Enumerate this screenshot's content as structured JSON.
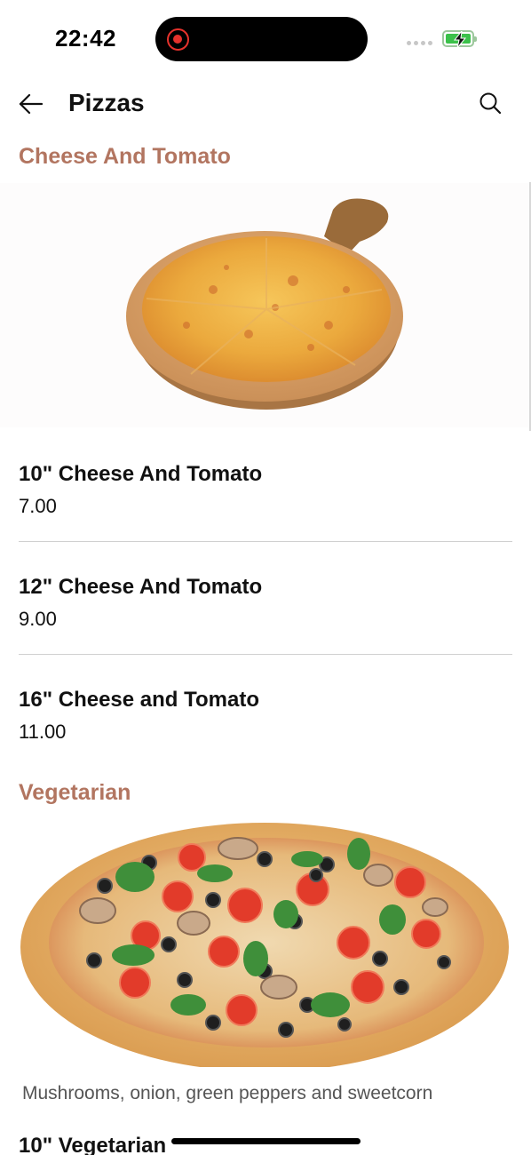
{
  "status_bar": {
    "time": "22:42",
    "recording_indicator": "record-icon",
    "battery": {
      "charging": true,
      "color": "#3bc14a"
    }
  },
  "header": {
    "title": "Pizzas",
    "back_icon": "arrow-left-icon",
    "search_icon": "search-icon"
  },
  "sections": [
    {
      "title": "Cheese And Tomato",
      "image": "cheese-and-tomato-pizza-image",
      "items": [
        {
          "name": "10\" Cheese And Tomato",
          "price": "7.00"
        },
        {
          "name": "12\" Cheese And Tomato",
          "price": "9.00"
        },
        {
          "name": "16\" Cheese and Tomato",
          "price": "11.00"
        }
      ]
    },
    {
      "title": "Vegetarian",
      "image": "vegetarian-pizza-image",
      "description": "Mushrooms, onion, green peppers and sweetcorn",
      "items": [
        {
          "name": "10\" Vegetarian"
        }
      ]
    }
  ],
  "colors": {
    "section_title": "#b27560",
    "divider": "#d0d0d0"
  }
}
